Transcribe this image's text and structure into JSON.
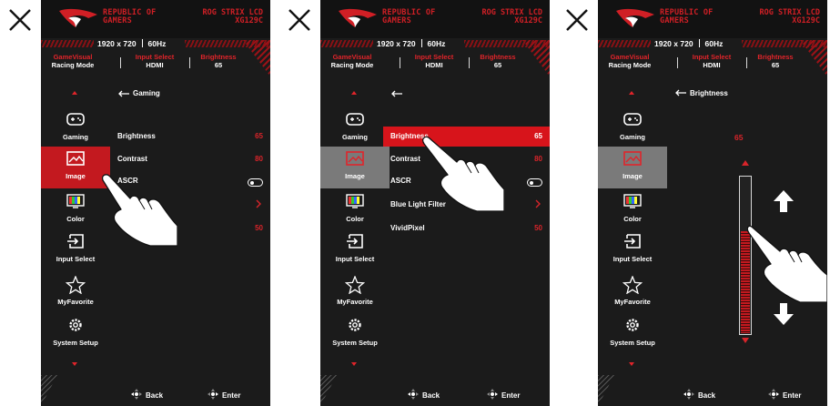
{
  "header": {
    "brand_line1": "REPUBLIC OF",
    "brand_line2": "GAMERS",
    "model_line1": "ROG STRIX LCD",
    "model_line2": "XG129C",
    "resolution": "1920 x 720",
    "refresh": "60Hz"
  },
  "status": {
    "gamevisual_label": "GameVisual",
    "gamevisual_value": "Racing Mode",
    "input_label": "Input Select",
    "input_value": "HDMI",
    "brightness_label": "Brightness",
    "brightness_value": "65"
  },
  "sidebar": {
    "items": [
      {
        "label": "Gaming",
        "icon": "gamepad-icon"
      },
      {
        "label": "Image",
        "icon": "image-icon"
      },
      {
        "label": "Color",
        "icon": "color-bars-icon"
      },
      {
        "label": "Input Select",
        "icon": "input-icon"
      },
      {
        "label": "MyFavorite",
        "icon": "star-icon"
      },
      {
        "label": "System Setup",
        "icon": "gear-icon"
      }
    ]
  },
  "panel1": {
    "breadcrumb": "Gaming",
    "rows": [
      {
        "label": "Brightness",
        "value": "65"
      },
      {
        "label": "Contrast",
        "value": "80"
      },
      {
        "label": "ASCR",
        "value": ""
      },
      {
        "label": "",
        "value": ""
      },
      {
        "label": "",
        "value": "50"
      }
    ]
  },
  "panel2": {
    "breadcrumb": "",
    "rows": [
      {
        "label": "Brightness",
        "value": "65"
      },
      {
        "label": "Contrast",
        "value": "80"
      },
      {
        "label": "ASCR",
        "value": ""
      },
      {
        "label": "Blue Light Filter",
        "value": ""
      },
      {
        "label": "VividPixel",
        "value": "50"
      }
    ]
  },
  "panel3": {
    "breadcrumb": "Brightness",
    "slider_value": "65",
    "slider_level_percent": 65
  },
  "footer": {
    "back_label": "Back",
    "enter_label": "Enter"
  },
  "colors": {
    "accent": "#d7141b",
    "background": "#1b1b1b",
    "selected_gray": "#7a7a7a"
  }
}
